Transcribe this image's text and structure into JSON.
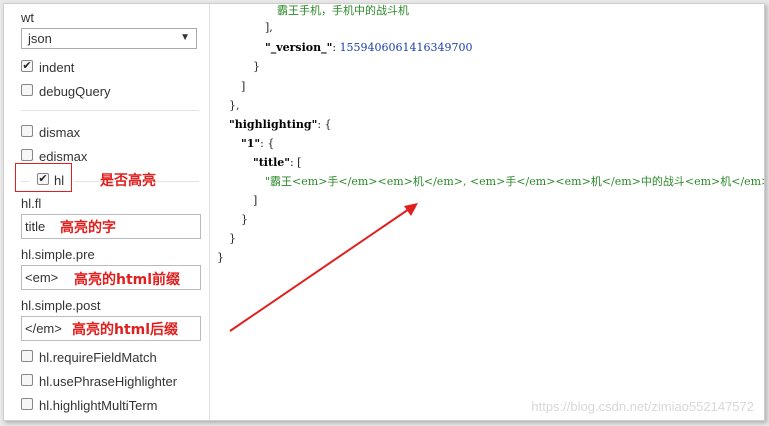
{
  "form": {
    "wt_label": "wt",
    "wt_value": "json",
    "indent_label": "indent",
    "debugQuery_label": "debugQuery",
    "dismax_label": "dismax",
    "edismax_label": "edismax",
    "hl_label": "hl",
    "hl_fl_label": "hl.fl",
    "hl_fl_value": "title",
    "hl_pre_label": "hl.simple.pre",
    "hl_pre_value": "<em>",
    "hl_post_label": "hl.simple.post",
    "hl_post_value": "</em>",
    "requireFieldMatch_label": "hl.requireFieldMatch",
    "usePhrase_label": "hl.usePhraseHighlighter",
    "multiTerm_label": "hl.highlightMultiTerm"
  },
  "annotations": {
    "hl_note": "是否高亮",
    "fl_note": "高亮的字",
    "pre_note": "高亮的html前缀",
    "post_note": "高亮的html后缀",
    "accent_color": "#e0201f"
  },
  "json_output": {
    "l1": "霸王手机，手机中的战斗机",
    "l2": "],",
    "l3_key": "\"_version_\"",
    "l3_val": "1559406061416349700",
    "l4": "}",
    "l5": "]",
    "l6": "},",
    "l7_key": "\"highlighting\"",
    "l7_rest": ": {",
    "l8_key": "\"1\"",
    "l8_rest": ": {",
    "l9_key": "\"title\"",
    "l9_rest": ": [",
    "l10": "\"霸王<em>手</em><em>机</em>, <em>手</em><em>机</em>中的战斗<em>机</em>\"",
    "l11": "]",
    "l12": "}",
    "l13": "}",
    "l14": "}"
  },
  "watermark": "https://blog.csdn.net/zimiao552147572"
}
